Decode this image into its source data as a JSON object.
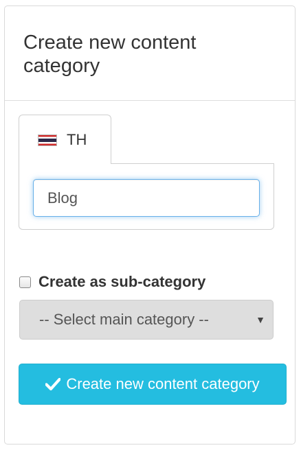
{
  "panel": {
    "title": "Create new content category"
  },
  "language_tab": {
    "flag_icon": "thailand-flag-icon",
    "label": "TH"
  },
  "category_name": {
    "value": "Blog"
  },
  "subcategory": {
    "checked": false,
    "label": "Create as sub-category"
  },
  "main_category_select": {
    "selected": "-- Select main category --",
    "caret_icon": "caret-down-icon"
  },
  "submit": {
    "icon": "check-icon",
    "label": "Create new content category",
    "color": "#24bde0"
  },
  "colors": {
    "flag_red": "#cf2b2b",
    "flag_white": "#ffffff",
    "flag_blue": "#2d2a4a"
  }
}
